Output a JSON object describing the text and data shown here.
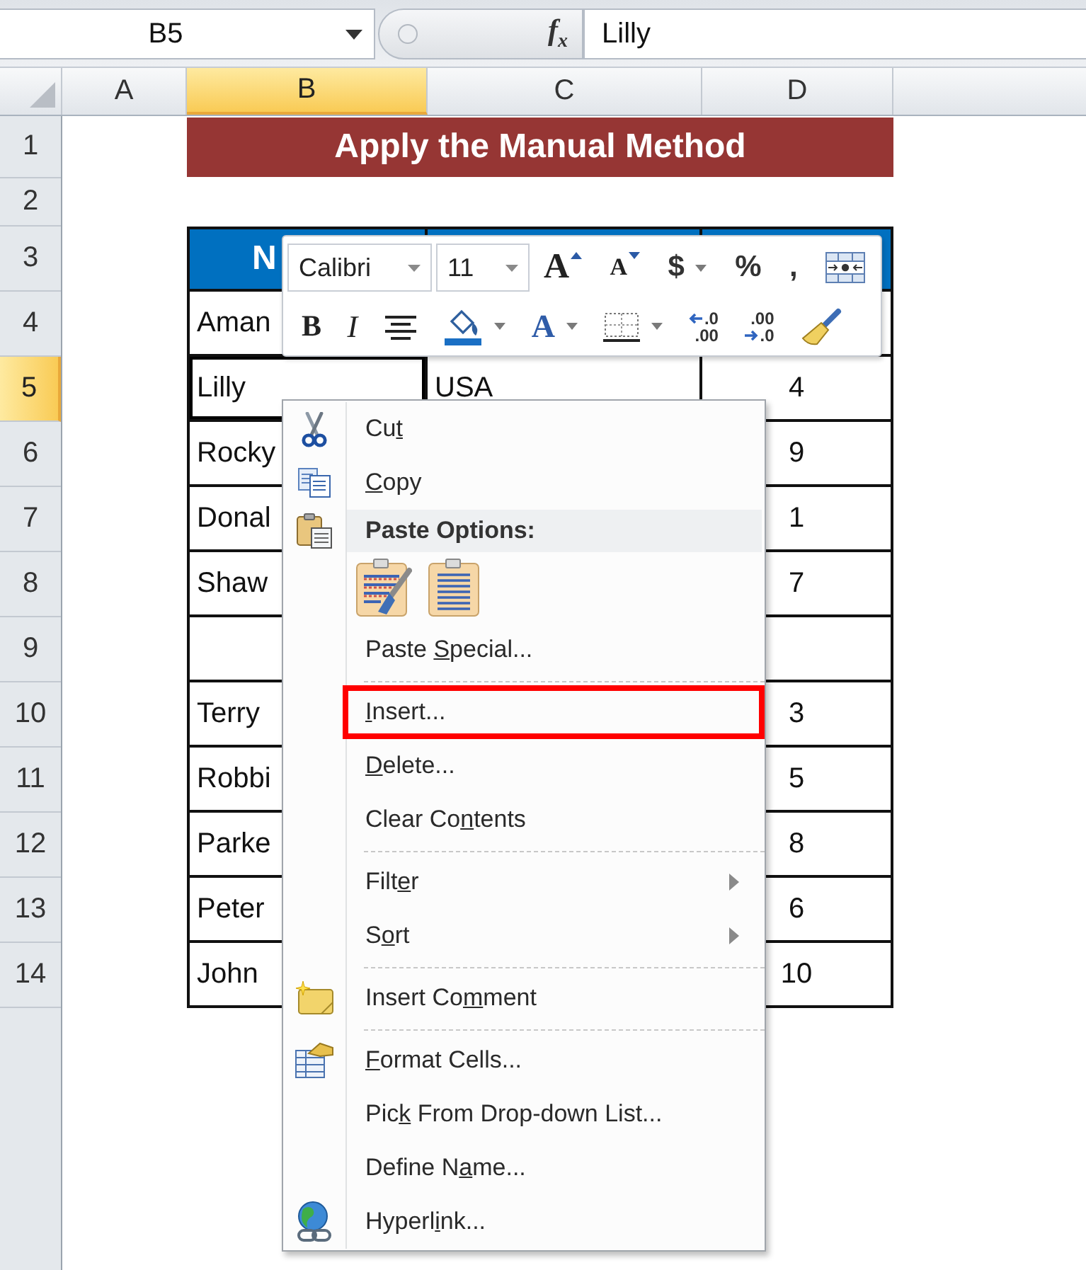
{
  "formula_bar": {
    "name_box": "B5",
    "function_label": "f$_{x}$",
    "formula": "Lilly"
  },
  "column_headers": [
    {
      "label": "A",
      "selected": false
    },
    {
      "label": "B",
      "selected": true
    },
    {
      "label": "C",
      "selected": false
    },
    {
      "label": "D",
      "selected": false
    }
  ],
  "row_headers": [
    {
      "label": "1",
      "selected": false
    },
    {
      "label": "2",
      "selected": false
    },
    {
      "label": "3",
      "selected": false
    },
    {
      "label": "4",
      "selected": false
    },
    {
      "label": "5",
      "selected": true
    },
    {
      "label": "6",
      "selected": false
    },
    {
      "label": "7",
      "selected": false
    },
    {
      "label": "8",
      "selected": false
    },
    {
      "label": "9",
      "selected": false
    },
    {
      "label": "10",
      "selected": false
    },
    {
      "label": "11",
      "selected": false
    },
    {
      "label": "12",
      "selected": false
    },
    {
      "label": "13",
      "selected": false
    },
    {
      "label": "14",
      "selected": false
    }
  ],
  "title": "Apply the Manual Method",
  "table": {
    "header": "N",
    "rows": [
      {
        "column_1": "Aman",
        "selected": false
      },
      {
        "column_1": "Lilly",
        "column_2": "USA",
        "column_3": "4",
        "selected": true
      },
      {
        "column_1": "Rocky",
        "column_3": "9",
        "selected": false
      },
      {
        "column_1": "Donal",
        "column_3": "1",
        "selected": false
      },
      {
        "column_1": "Shaw",
        "column_3": "7",
        "selected": false
      },
      {
        "selected": false
      },
      {
        "column_1": "Terry",
        "column_3": "3",
        "selected": false
      },
      {
        "column_1": "Robbi",
        "column_3": "5",
        "selected": false
      },
      {
        "column_1": "Parke",
        "column_3": "8",
        "selected": false
      },
      {
        "column_1": "Peter",
        "column_3": "6",
        "selected": false
      },
      {
        "column_1": "John",
        "column_3": "10",
        "selected": false
      }
    ]
  },
  "mini_toolbar": {
    "font_name": "Calibri",
    "font_size": "11",
    "rows": [
      [
        {
          "kind": "grow",
          "glyph": "A",
          "dropdown": false
        },
        {
          "kind": "shrink",
          "glyph": "A",
          "dropdown": false
        },
        {
          "kind": "glyph",
          "glyph": "$",
          "dropdown": true
        },
        {
          "kind": "glyph",
          "glyph": "%",
          "dropdown": false
        },
        {
          "kind": "glyph",
          "glyph": ",",
          "dropdown": false
        },
        {
          "kind": "merge",
          "dropdown": false
        }
      ],
      [
        {
          "kind": "bold",
          "glyph": "B",
          "dropdown": false
        },
        {
          "kind": "italic",
          "glyph": "I",
          "dropdown": false
        },
        {
          "kind": "align",
          "dropdown": false
        },
        {
          "kind": "fill",
          "dropdown": true
        },
        {
          "kind": "font-color",
          "glyph": "A",
          "dropdown": true
        },
        {
          "kind": "borders",
          "dropdown": true
        },
        {
          "kind": "increase-decimal",
          "lines": [
            ".0",
            ".00"
          ],
          "dropdown": false
        },
        {
          "kind": "decrease-decimal",
          "lines": [
            ".00",
            ".0"
          ],
          "dropdown": false
        },
        {
          "kind": "painter",
          "dropdown": false
        }
      ]
    ]
  },
  "context_menu": {
    "sections": [
      {
        "items": [
          {
            "kind": "cut",
            "label": {
              "before": "Cu",
              "key": "t"
            },
            "highlighted": false
          },
          {
            "kind": "copy",
            "label": {
              "key": "C",
              "after": "opy"
            },
            "highlighted": false
          },
          {
            "kind": "heading",
            "label": {
              "before": "Paste Options:"
            },
            "highlighted": false
          },
          {
            "kind": "paste-buttons",
            "buttons": [
              {
                "kind": "formatting"
              },
              {
                "kind": "values"
              }
            ],
            "highlighted": false
          },
          {
            "kind": "command",
            "label": {
              "before": "Paste ",
              "key": "S",
              "after": "pecial..."
            },
            "highlighted": false
          }
        ]
      },
      {
        "items": [
          {
            "kind": "command",
            "label": {
              "key": "I",
              "after": "nsert..."
            },
            "highlighted": true
          },
          {
            "kind": "command",
            "label": {
              "key": "D",
              "after": "elete..."
            },
            "highlighted": false
          },
          {
            "kind": "command",
            "label": {
              "before": "Clear Co",
              "key": "n",
              "after": "tents"
            },
            "highlighted": false
          }
        ]
      },
      {
        "items": [
          {
            "kind": "submenu",
            "label": {
              "before": "Filt",
              "key": "e",
              "after": "r"
            },
            "highlighted": false
          },
          {
            "kind": "submenu",
            "label": {
              "before": "S",
              "key": "o",
              "after": "rt"
            },
            "highlighted": false
          }
        ]
      },
      {
        "items": [
          {
            "kind": "comment",
            "label": {
              "before": "Insert Co",
              "key": "m",
              "after": "ment"
            },
            "highlighted": false
          }
        ]
      },
      {
        "items": [
          {
            "kind": "format",
            "label": {
              "key": "F",
              "after": "ormat Cells..."
            },
            "highlighted": false
          },
          {
            "kind": "command",
            "label": {
              "before": "Pic",
              "key": "k",
              "after": " From Drop-down List..."
            },
            "highlighted": false
          },
          {
            "kind": "command",
            "label": {
              "before": "Define N",
              "key": "a",
              "after": "me..."
            },
            "highlighted": false
          },
          {
            "kind": "link",
            "label": {
              "before": "Hyperl",
              "key": "i",
              "after": "nk..."
            },
            "highlighted": false
          }
        ]
      }
    ]
  }
}
